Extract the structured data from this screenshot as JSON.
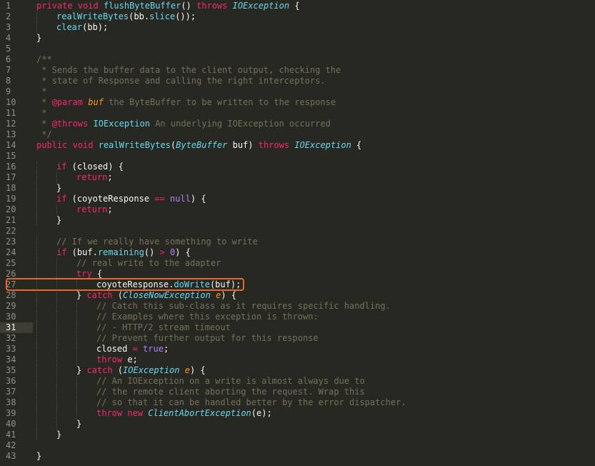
{
  "editor": {
    "current_line": 31,
    "highlighted_line": 27,
    "colors": {
      "background": "#272822",
      "gutter_text": "#8f908a",
      "keyword": "#f92672",
      "function": "#66d9ef",
      "comment": "#75715e",
      "parameter": "#fd971f",
      "constant": "#ae81ff",
      "highlight_box": "#e8662c"
    },
    "lines": [
      {
        "n": "1",
        "indent": 0,
        "tokens": [
          [
            "kw",
            "private"
          ],
          [
            "tx",
            " "
          ],
          [
            "kw",
            "void"
          ],
          [
            "tx",
            " "
          ],
          [
            "fn",
            "flushByteBuffer"
          ],
          [
            "tx",
            "() "
          ],
          [
            "kw",
            "throws"
          ],
          [
            "tx",
            " "
          ],
          [
            "ty",
            "IOException"
          ],
          [
            "tx",
            " {"
          ]
        ]
      },
      {
        "n": "2",
        "indent": 1,
        "tokens": [
          [
            "fn",
            "realWriteBytes"
          ],
          [
            "tx",
            "(bb."
          ],
          [
            "fn",
            "slice"
          ],
          [
            "tx",
            "());"
          ]
        ]
      },
      {
        "n": "3",
        "indent": 1,
        "tokens": [
          [
            "fn",
            "clear"
          ],
          [
            "tx",
            "(bb);"
          ]
        ]
      },
      {
        "n": "4",
        "indent": 0,
        "tokens": [
          [
            "tx",
            "}"
          ]
        ]
      },
      {
        "n": "5",
        "indent": 0,
        "tokens": []
      },
      {
        "n": "6",
        "indent": 0,
        "tokens": [
          [
            "cm",
            "/**"
          ]
        ]
      },
      {
        "n": "7",
        "indent": 0,
        "tokens": [
          [
            "cm",
            " * Sends the buffer data to the client output, checking the"
          ]
        ]
      },
      {
        "n": "8",
        "indent": 0,
        "tokens": [
          [
            "cm",
            " * state of Response and calling the right interceptors."
          ]
        ]
      },
      {
        "n": "9",
        "indent": 0,
        "tokens": [
          [
            "cm",
            " *"
          ]
        ]
      },
      {
        "n": "10",
        "indent": 0,
        "tokens": [
          [
            "cm",
            " * "
          ],
          [
            "an",
            "@param"
          ],
          [
            "tx",
            " "
          ],
          [
            "pa",
            "buf"
          ],
          [
            "cm",
            " the ByteBuffer to be written to the response"
          ]
        ]
      },
      {
        "n": "11",
        "indent": 0,
        "tokens": [
          [
            "cm",
            " *"
          ]
        ]
      },
      {
        "n": "12",
        "indent": 0,
        "tokens": [
          [
            "cm",
            " * "
          ],
          [
            "an",
            "@throws"
          ],
          [
            "tx",
            " "
          ],
          [
            "fn",
            "IOException"
          ],
          [
            "cm",
            " An underlying IOException occurred"
          ]
        ]
      },
      {
        "n": "13",
        "indent": 0,
        "tokens": [
          [
            "cm",
            " */"
          ]
        ]
      },
      {
        "n": "14",
        "indent": 0,
        "tokens": [
          [
            "kw",
            "public"
          ],
          [
            "tx",
            " "
          ],
          [
            "kw",
            "void"
          ],
          [
            "tx",
            " "
          ],
          [
            "fn",
            "realWriteBytes"
          ],
          [
            "tx",
            "("
          ],
          [
            "ty",
            "ByteBuffer"
          ],
          [
            "tx",
            " buf) "
          ],
          [
            "kw",
            "throws"
          ],
          [
            "tx",
            " "
          ],
          [
            "ty",
            "IOException"
          ],
          [
            "tx",
            " {"
          ]
        ]
      },
      {
        "n": "15",
        "indent": 0,
        "tokens": []
      },
      {
        "n": "16",
        "indent": 1,
        "tokens": [
          [
            "kw",
            "if"
          ],
          [
            "tx",
            " (closed) {"
          ]
        ]
      },
      {
        "n": "17",
        "indent": 2,
        "tokens": [
          [
            "kw",
            "return"
          ],
          [
            "tx",
            ";"
          ]
        ]
      },
      {
        "n": "18",
        "indent": 1,
        "tokens": [
          [
            "tx",
            "}"
          ]
        ]
      },
      {
        "n": "19",
        "indent": 1,
        "tokens": [
          [
            "kw",
            "if"
          ],
          [
            "tx",
            " (coyoteResponse "
          ],
          [
            "kw",
            "=="
          ],
          [
            "tx",
            " "
          ],
          [
            "bl",
            "null"
          ],
          [
            "tx",
            ") {"
          ]
        ]
      },
      {
        "n": "20",
        "indent": 2,
        "tokens": [
          [
            "kw",
            "return"
          ],
          [
            "tx",
            ";"
          ]
        ]
      },
      {
        "n": "21",
        "indent": 1,
        "tokens": [
          [
            "tx",
            "}"
          ]
        ]
      },
      {
        "n": "22",
        "indent": 0,
        "tokens": []
      },
      {
        "n": "23",
        "indent": 1,
        "tokens": [
          [
            "cm",
            "// If we really have something to write"
          ]
        ]
      },
      {
        "n": "24",
        "indent": 1,
        "tokens": [
          [
            "kw",
            "if"
          ],
          [
            "tx",
            " (buf."
          ],
          [
            "fn",
            "remaining"
          ],
          [
            "tx",
            "() "
          ],
          [
            "kw",
            ">"
          ],
          [
            "tx",
            " "
          ],
          [
            "bl",
            "0"
          ],
          [
            "tx",
            ") {"
          ]
        ]
      },
      {
        "n": "25",
        "indent": 2,
        "tokens": [
          [
            "cm",
            "// real write to the adapter"
          ]
        ]
      },
      {
        "n": "26",
        "indent": 2,
        "tokens": [
          [
            "kw",
            "try"
          ],
          [
            "tx",
            " {"
          ]
        ]
      },
      {
        "n": "27",
        "indent": 3,
        "tokens": [
          [
            "tx",
            "coyoteResponse."
          ],
          [
            "fn",
            "doWrite"
          ],
          [
            "tx",
            "(buf);"
          ]
        ]
      },
      {
        "n": "28",
        "indent": 2,
        "tokens": [
          [
            "tx",
            "} "
          ],
          [
            "kw",
            "catch"
          ],
          [
            "tx",
            " ("
          ],
          [
            "ty",
            "CloseNowException"
          ],
          [
            "tx",
            " "
          ],
          [
            "pa",
            "e"
          ],
          [
            "tx",
            ") {"
          ]
        ]
      },
      {
        "n": "29",
        "indent": 3,
        "tokens": [
          [
            "cm",
            "// Catch this sub-class as it requires specific handling."
          ]
        ]
      },
      {
        "n": "30",
        "indent": 3,
        "tokens": [
          [
            "cm",
            "// Examples where this exception is thrown:"
          ]
        ]
      },
      {
        "n": "31",
        "indent": 3,
        "tokens": [
          [
            "cm",
            "// - HTTP/2 stream timeout"
          ]
        ]
      },
      {
        "n": "32",
        "indent": 3,
        "tokens": [
          [
            "cm",
            "// Prevent further output for this response"
          ]
        ]
      },
      {
        "n": "33",
        "indent": 3,
        "tokens": [
          [
            "tx",
            "closed "
          ],
          [
            "kw",
            "="
          ],
          [
            "tx",
            " "
          ],
          [
            "bl",
            "true"
          ],
          [
            "tx",
            ";"
          ]
        ]
      },
      {
        "n": "34",
        "indent": 3,
        "tokens": [
          [
            "kw",
            "throw"
          ],
          [
            "tx",
            " e;"
          ]
        ]
      },
      {
        "n": "35",
        "indent": 2,
        "tokens": [
          [
            "tx",
            "} "
          ],
          [
            "kw",
            "catch"
          ],
          [
            "tx",
            " ("
          ],
          [
            "ty",
            "IOException"
          ],
          [
            "tx",
            " "
          ],
          [
            "pa",
            "e"
          ],
          [
            "tx",
            ") {"
          ]
        ]
      },
      {
        "n": "36",
        "indent": 3,
        "tokens": [
          [
            "cm",
            "// An IOException on a write is almost always due to"
          ]
        ]
      },
      {
        "n": "37",
        "indent": 3,
        "tokens": [
          [
            "cm",
            "// the remote client aborting the request. Wrap this"
          ]
        ]
      },
      {
        "n": "38",
        "indent": 3,
        "tokens": [
          [
            "cm",
            "// so that it can be handled better by the error dispatcher."
          ]
        ]
      },
      {
        "n": "39",
        "indent": 3,
        "tokens": [
          [
            "kw",
            "throw"
          ],
          [
            "tx",
            " "
          ],
          [
            "kw",
            "new"
          ],
          [
            "tx",
            " "
          ],
          [
            "ty",
            "ClientAbortException"
          ],
          [
            "tx",
            "(e);"
          ]
        ]
      },
      {
        "n": "40",
        "indent": 2,
        "tokens": [
          [
            "tx",
            "}"
          ]
        ]
      },
      {
        "n": "41",
        "indent": 1,
        "tokens": [
          [
            "tx",
            "}"
          ]
        ]
      },
      {
        "n": "42",
        "indent": 0,
        "tokens": []
      },
      {
        "n": "43",
        "indent": 0,
        "tokens": [
          [
            "tx",
            "}"
          ]
        ]
      }
    ]
  }
}
